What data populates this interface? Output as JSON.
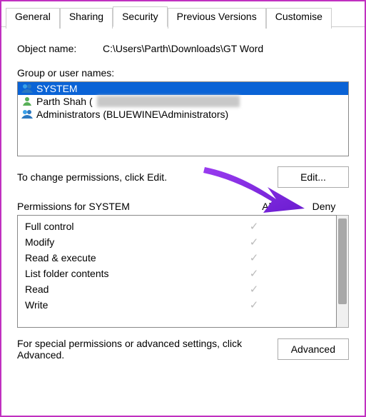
{
  "tabs": {
    "general": "General",
    "sharing": "Sharing",
    "security": "Security",
    "previous": "Previous Versions",
    "customise": "Customise"
  },
  "object_label": "Object name:",
  "object_value": "C:\\Users\\Parth\\Downloads\\GT Word",
  "group_label": "Group or user names:",
  "users": {
    "system": "SYSTEM",
    "parth_prefix": "Parth Shah (",
    "parth_suffix": "",
    "admins": "Administrators (BLUEWINE\\Administrators)"
  },
  "edit_text": "To change permissions, click Edit.",
  "edit_button": "Edit...",
  "perm_header": "Permissions for SYSTEM",
  "allow": "Allow",
  "deny": "Deny",
  "perms": {
    "p0": "Full control",
    "p1": "Modify",
    "p2": "Read & execute",
    "p3": "List folder contents",
    "p4": "Read",
    "p5": "Write"
  },
  "check": "✓",
  "adv_text": "For special permissions or advanced settings, click Advanced.",
  "adv_button": "Advanced"
}
